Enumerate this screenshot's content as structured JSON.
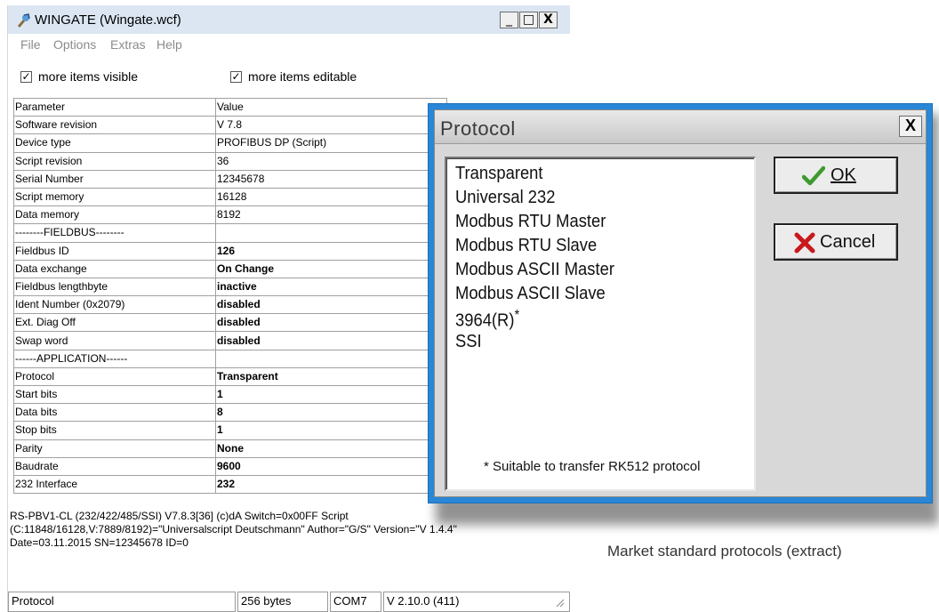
{
  "window": {
    "title": "WINGATE  (Wingate.wcf)",
    "controls": {
      "minimize": "_",
      "maximize": "□",
      "close": "X"
    }
  },
  "menu": {
    "items": [
      "File",
      "Options",
      "Extras",
      "Help"
    ]
  },
  "options": {
    "more_items_visible": {
      "label": "more items visible",
      "checked": true
    },
    "more_items_editable": {
      "label": "more items editable",
      "checked": true
    }
  },
  "table": {
    "headers": [
      "Parameter",
      "Value"
    ],
    "rows": [
      [
        "Software revision",
        "V 7.8"
      ],
      [
        "Device type",
        "PROFIBUS DP (Script)"
      ],
      [
        "Script revision",
        "36"
      ],
      [
        "Serial Number",
        "12345678"
      ],
      [
        "Script memory",
        "16128"
      ],
      [
        "Data memory",
        "8192"
      ],
      [
        "--------FIELDBUS--------",
        ""
      ],
      [
        "Fieldbus ID",
        "126"
      ],
      [
        "Data exchange",
        "On Change"
      ],
      [
        "Fieldbus lengthbyte",
        "inactive"
      ],
      [
        "Ident Number (0x2079)",
        "disabled"
      ],
      [
        "Ext. Diag Off",
        "disabled"
      ],
      [
        "Swap word",
        "disabled"
      ],
      [
        "------APPLICATION------",
        ""
      ],
      [
        "Protocol",
        "Transparent"
      ],
      [
        "Start bits",
        "1"
      ],
      [
        "Data bits",
        "8"
      ],
      [
        "Stop bits",
        "1"
      ],
      [
        "Parity",
        "None"
      ],
      [
        "Baudrate",
        "9600"
      ],
      [
        "232 Interface",
        "232"
      ]
    ]
  },
  "info": {
    "line1": "RS-PBV1-CL (232/422/485/SSI) V7.8.3[36] (c)dA Switch=0x00FF Script",
    "line2": "(C:11848/16128,V:7889/8192)=\"Universalscript Deutschmann\" Author=\"G/S\" Version=\"V 1.4.4\"",
    "line3": "Date=03.11.2015 SN=12345678 ID=0"
  },
  "statusbar": {
    "field": "Protocol",
    "size": "256 bytes",
    "port": "COM7",
    "version": "V 2.10.0 (411)"
  },
  "dialog": {
    "title": "Protocol",
    "close": "X",
    "items": [
      "Transparent",
      "Universal 232",
      "Modbus RTU Master",
      "Modbus RTU Slave",
      "Modbus ASCII Master",
      "Modbus ASCII Slave",
      "3964(R)",
      "SSI"
    ],
    "asterisk": "*",
    "note": "* Suitable to transfer RK512 protocol",
    "ok_label": "OK",
    "cancel_label": "Cancel"
  },
  "caption": "Market standard protocols (extract)",
  "colors": {
    "dialog_frame": "#2a86d6",
    "titlebar": "#dbe6f2",
    "ok_check": "#3f9a2e",
    "cancel_x": "#c8191c"
  },
  "icons": [
    "wingate-app-icon",
    "checkmark-icon",
    "cancel-x-icon",
    "resize-grip-icon"
  ]
}
